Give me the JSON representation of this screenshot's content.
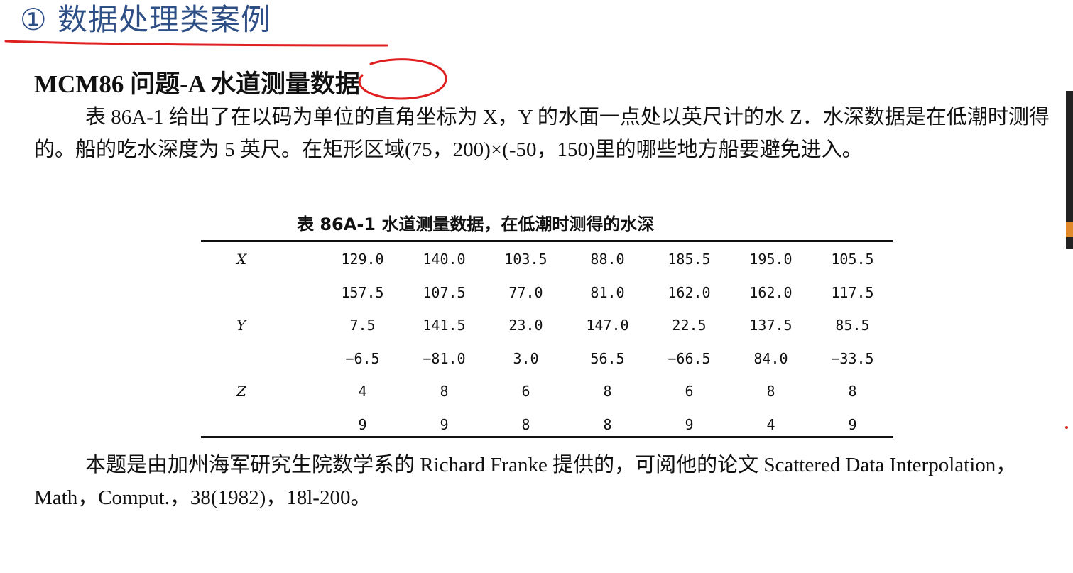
{
  "slide_title": "① 数据处理类案例",
  "problem_heading": "MCM86 问题-A  水道测量数据",
  "intro_paragraph": "表 86A-1 给出了在以码为单位的直角坐标为 X，Y 的水面一点处以英尺计的水 Z．水深数据是在低潮时测得的。船的吃水深度为 5 英尺。在矩形区域(75，200)×(-50，150)里的哪些地方船要避免进入。",
  "table": {
    "caption": "表 86A-1   水道测量数据，在低潮时测得的水深",
    "rows": [
      {
        "label": "X",
        "values": [
          "129.0",
          "140.0",
          "103.5",
          "88.0",
          "185.5",
          "195.0",
          "105.5"
        ]
      },
      {
        "label": "",
        "values": [
          "157.5",
          "107.5",
          "77.0",
          "81.0",
          "162.0",
          "162.0",
          "117.5"
        ]
      },
      {
        "label": "Y",
        "values": [
          "7.5",
          "141.5",
          "23.0",
          "147.0",
          "22.5",
          "137.5",
          "85.5"
        ]
      },
      {
        "label": "",
        "values": [
          "−6.5",
          "−81.0",
          "3.0",
          "56.5",
          "−66.5",
          "84.0",
          "−33.5"
        ]
      },
      {
        "label": "Z",
        "values": [
          "4",
          "8",
          "6",
          "8",
          "6",
          "8",
          "8"
        ]
      },
      {
        "label": "",
        "values": [
          "9",
          "9",
          "8",
          "8",
          "9",
          "4",
          "9"
        ]
      }
    ]
  },
  "source_paragraph": "本题是由加州海军研究生院数学系的 Richard Franke 提供的，可阅他的论文 Scattered Data Interpolation，Math，Comput.，38(1982)，18l-200。",
  "colors": {
    "title": "#2e4f86",
    "annotation": "#e02020"
  }
}
